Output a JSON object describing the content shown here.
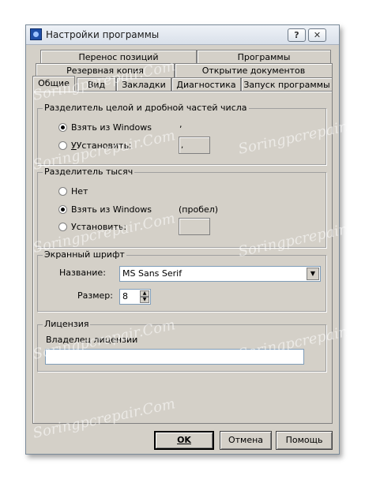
{
  "window": {
    "title": "Настройки программы",
    "help_glyph": "?",
    "close_glyph": "✕"
  },
  "tabs": {
    "row1": [
      "Перенос позиций",
      "Программы"
    ],
    "row2": [
      "Резервная копия",
      "Открытие документов"
    ],
    "row3": [
      "Общие",
      "Вид",
      "Закладки",
      "Диагностика",
      "Запуск программы"
    ],
    "active": "Общие"
  },
  "decimal_group": {
    "legend": "Разделитель целой и дробной частей числа",
    "from_windows": "Взять из Windows",
    "from_windows_value": ",",
    "set": "Установить:",
    "set_value": ","
  },
  "thousands_group": {
    "legend": "Разделитель тысяч",
    "none": "Нет",
    "from_windows": "Взять из Windows",
    "from_windows_value": "(пробел)",
    "set": "Установить:",
    "set_value": ""
  },
  "font_group": {
    "legend": "Экранный шрифт",
    "name_label": "Название:",
    "name_value": "MS Sans Serif",
    "size_label": "Размер:",
    "size_value": "8"
  },
  "license_group": {
    "legend": "Лицензия",
    "owner_label": "Владелец лицензии",
    "owner_value": ""
  },
  "buttons": {
    "ok": "OK",
    "cancel": "Отмена",
    "help": "Помощь"
  },
  "watermark": "Soringpcrepair.Com"
}
